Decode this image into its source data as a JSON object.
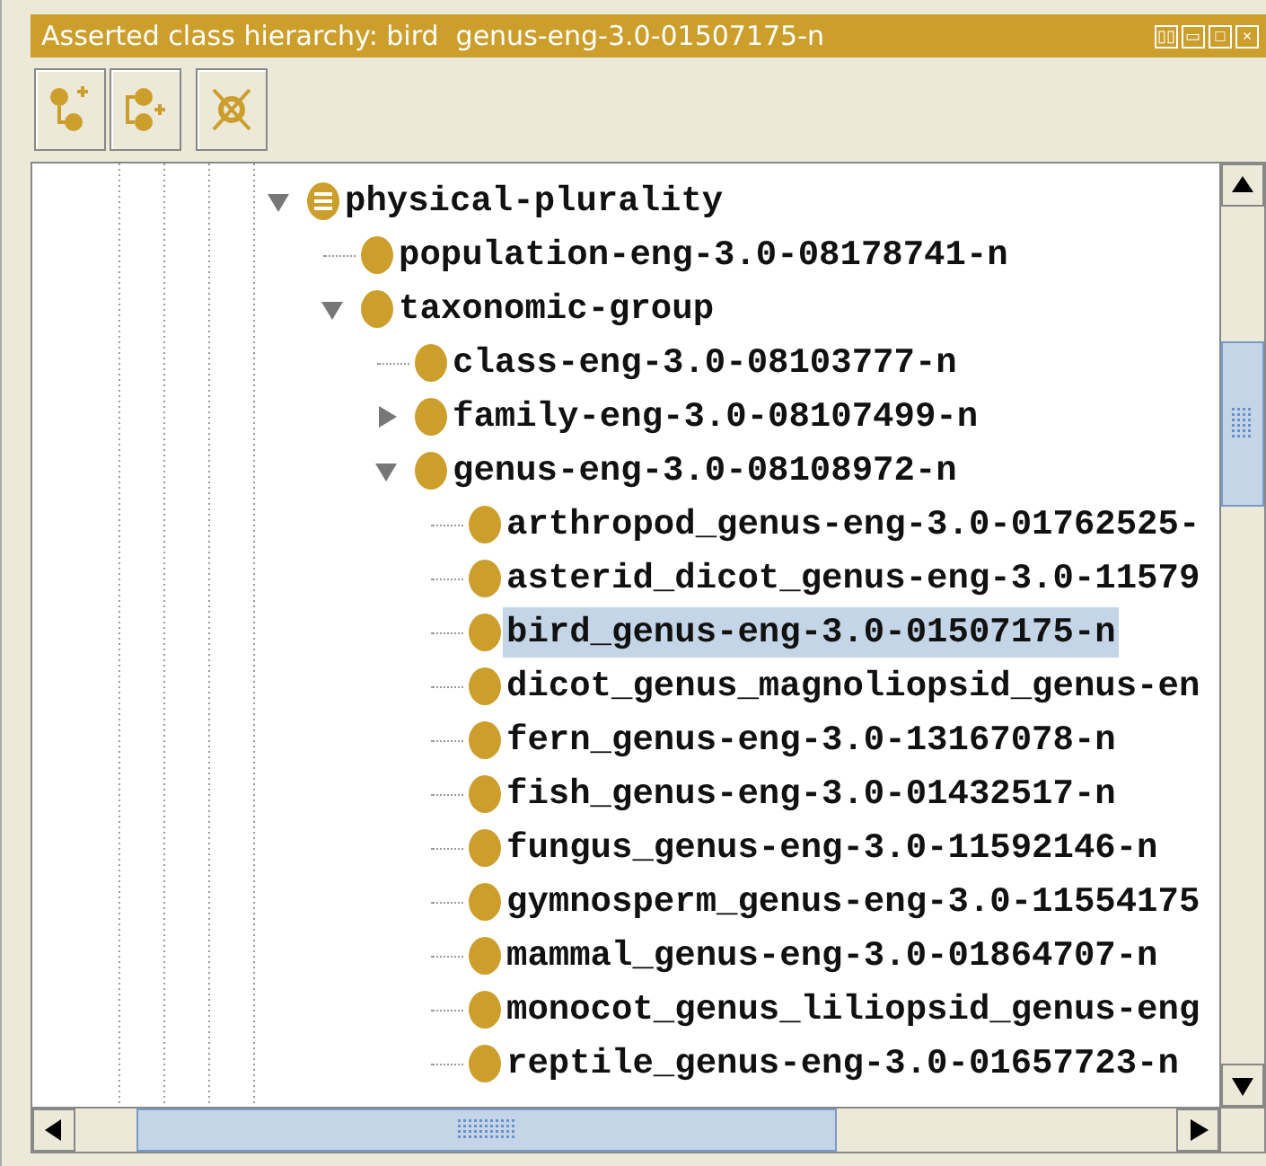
{
  "panel": {
    "title": "Asserted class hierarchy: bird  genus-eng-3.0-01507175-n",
    "window_controls": [
      "▯▯",
      "▭",
      "□",
      "×"
    ]
  },
  "toolbar": [
    {
      "kind": "add-subclass"
    },
    {
      "kind": "add-sibling"
    },
    {
      "kind": "delete"
    }
  ],
  "tree": [
    {
      "label": "physical-plurality",
      "kind": "defined",
      "expanded": true,
      "selected": false,
      "children": [
        {
          "label": "population-eng-3.0-08178741-n",
          "kind": "class",
          "selected": false
        },
        {
          "label": "taxonomic-group",
          "kind": "class",
          "expanded": true,
          "selected": false,
          "children": [
            {
              "label": "class-eng-3.0-08103777-n",
              "kind": "class",
              "selected": false
            },
            {
              "label": "family-eng-3.0-08107499-n",
              "kind": "class",
              "expanded": false,
              "selected": false
            },
            {
              "label": "genus-eng-3.0-08108972-n",
              "kind": "class",
              "expanded": true,
              "selected": false,
              "children": [
                {
                  "label": "arthropod_genus-eng-3.0-01762525-",
                  "kind": "class",
                  "selected": false
                },
                {
                  "label": "asterid_dicot_genus-eng-3.0-11579",
                  "kind": "class",
                  "selected": false
                },
                {
                  "label": "bird_genus-eng-3.0-01507175-n",
                  "kind": "class",
                  "selected": true
                },
                {
                  "label": "dicot_genus_magnoliopsid_genus-en",
                  "kind": "class",
                  "selected": false
                },
                {
                  "label": "fern_genus-eng-3.0-13167078-n",
                  "kind": "class",
                  "selected": false
                },
                {
                  "label": "fish_genus-eng-3.0-01432517-n",
                  "kind": "class",
                  "selected": false
                },
                {
                  "label": "fungus_genus-eng-3.0-11592146-n",
                  "kind": "class",
                  "selected": false
                },
                {
                  "label": "gymnosperm_genus-eng-3.0-11554175",
                  "kind": "class",
                  "selected": false
                },
                {
                  "label": "mammal_genus-eng-3.0-01864707-n",
                  "kind": "class",
                  "selected": false
                },
                {
                  "label": "monocot_genus_liliopsid_genus-eng",
                  "kind": "class",
                  "selected": false
                },
                {
                  "label": "reptile_genus-eng-3.0-01657723-n",
                  "kind": "class",
                  "selected": false
                }
              ]
            }
          ]
        }
      ]
    }
  ]
}
